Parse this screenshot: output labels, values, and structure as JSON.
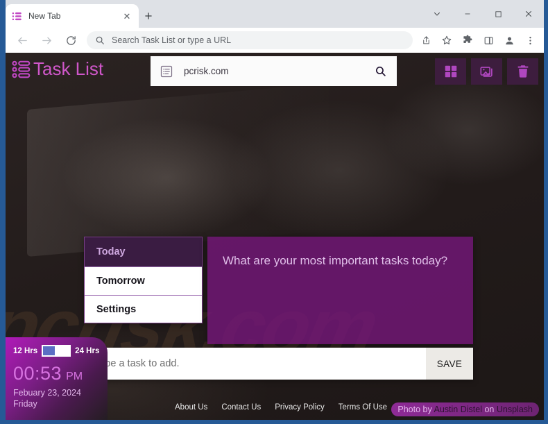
{
  "browser": {
    "tab": {
      "title": "New Tab",
      "favicon_icon": "task-list-icon",
      "close_icon": "close-icon"
    },
    "new_tab_label": "+",
    "window_controls": [
      {
        "name": "tab-search",
        "icon": "chevron-down-icon",
        "glyph": "∨"
      },
      {
        "name": "minimize",
        "icon": "minimize-icon",
        "glyph": "—"
      },
      {
        "name": "maximize",
        "icon": "maximize-icon",
        "glyph": "□"
      },
      {
        "name": "close",
        "icon": "close-icon",
        "glyph": "✕"
      }
    ],
    "nav": {
      "back_icon": "arrow-left-icon",
      "forward_icon": "arrow-right-icon",
      "reload_icon": "reload-icon"
    },
    "omnibox": {
      "search_icon": "search-icon",
      "placeholder": "Search Task List or type a URL",
      "value": "Search Task List or type a URL"
    },
    "toolbar_icons": [
      {
        "name": "share-button",
        "icon": "share-icon"
      },
      {
        "name": "bookmark-button",
        "icon": "star-icon"
      },
      {
        "name": "extensions-button",
        "icon": "puzzle-icon"
      },
      {
        "name": "side-panel-button",
        "icon": "side-panel-icon"
      },
      {
        "name": "profile-button",
        "icon": "person-icon"
      },
      {
        "name": "chrome-menu-button",
        "icon": "kebab-menu-icon"
      }
    ]
  },
  "app": {
    "brand": {
      "title": "Task List",
      "icon": "task-list-icon",
      "color": "#cf57c9"
    },
    "search": {
      "value": "pcrisk.com",
      "placeholder": "pcrisk.com",
      "left_icon": "list-icon",
      "go_icon": "search-icon"
    },
    "actions": [
      {
        "name": "apps-grid-button",
        "icon": "grid-icon"
      },
      {
        "name": "wallpaper-button",
        "icon": "image-icon"
      },
      {
        "name": "delete-button",
        "icon": "trash-icon"
      }
    ],
    "menu": {
      "items": [
        {
          "label": "Today",
          "active": true
        },
        {
          "label": "Tomorrow",
          "active": false
        },
        {
          "label": "Settings",
          "active": false
        }
      ]
    },
    "prompt": {
      "text": "What are your most important tasks today?"
    },
    "add_task": {
      "placeholder": "Type a task to add.",
      "value": "",
      "save_label": "SAVE"
    },
    "clock": {
      "label_12": "12 Hrs",
      "label_24": "24 Hrs",
      "toggle_state": "12",
      "time": "00:53",
      "meridiem": "PM",
      "date": "Febuary 23, 2024",
      "weekday": "Friday"
    },
    "footer": {
      "links": [
        "About Us",
        "Contact Us",
        "Privacy Policy",
        "Terms Of Use"
      ],
      "credit": {
        "prefix": "Photo by",
        "author": "Austin Distel",
        "middle": "on",
        "source": "Unsplash"
      }
    },
    "watermark": "pcrisk.com"
  }
}
